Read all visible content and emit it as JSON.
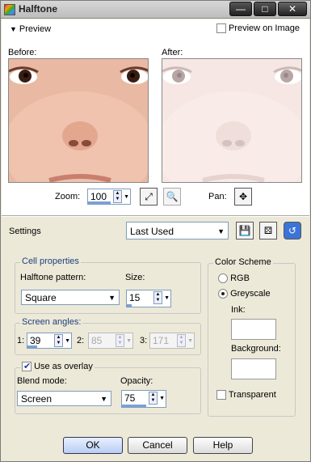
{
  "window": {
    "title": "Halftone"
  },
  "titlebar_buttons": {
    "minimize": "—",
    "maximize": "□",
    "close": "✕"
  },
  "preview": {
    "header": "Preview",
    "preview_on_image_label": "Preview on Image",
    "preview_on_image_checked": false,
    "before_label": "Before:",
    "after_label": "After:"
  },
  "zoom": {
    "label": "Zoom:",
    "value": "100",
    "pan_label": "Pan:"
  },
  "settings": {
    "label": "Settings",
    "preset": "Last Used"
  },
  "cell_properties": {
    "title": "Cell properties",
    "pattern_label": "Halftone pattern:",
    "pattern_value": "Square",
    "size_label": "Size:",
    "size_value": "15"
  },
  "screen_angles": {
    "title": "Screen angles:",
    "a1_label": "1:",
    "a1_value": "39",
    "a2_label": "2:",
    "a2_value": "85",
    "a3_label": "3:",
    "a3_value": "171"
  },
  "overlay": {
    "use_label": "Use as overlay",
    "use_checked": true,
    "blend_label": "Blend mode:",
    "blend_value": "Screen",
    "opacity_label": "Opacity:",
    "opacity_value": "75"
  },
  "color_scheme": {
    "title": "Color Scheme",
    "rgb_label": "RGB",
    "greyscale_label": "Greyscale",
    "selected": "Greyscale",
    "ink_label": "Ink:",
    "background_label": "Background:",
    "transparent_label": "Transparent",
    "transparent_checked": false
  },
  "buttons": {
    "ok": "OK",
    "cancel": "Cancel",
    "help": "Help"
  }
}
